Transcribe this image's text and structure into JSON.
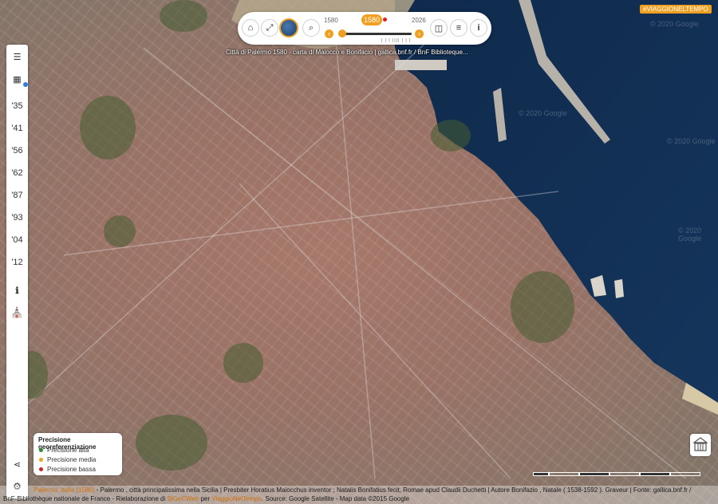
{
  "map": {
    "watermark": "© 2020 Google",
    "hashtag": "#VIAGGIONELTEMPO",
    "caption": "Città di Palermo 1580 - carta di Maiocco e Bonifacio | gallica.bnf.fr / BnF Biblioteque..."
  },
  "sidebar": {
    "items": [
      {
        "id": "menu",
        "icon": "menu-icon",
        "glyph": "☰"
      },
      {
        "id": "map",
        "icon": "map-icon",
        "glyph": "▦"
      },
      {
        "id": "35",
        "label": "'35"
      },
      {
        "id": "41",
        "label": "'41"
      },
      {
        "id": "56",
        "label": "'56"
      },
      {
        "id": "62",
        "label": "'62"
      },
      {
        "id": "87",
        "label": "'87"
      },
      {
        "id": "93",
        "label": "'93"
      },
      {
        "id": "04",
        "label": "'04"
      },
      {
        "id": "12",
        "label": "'12"
      },
      {
        "id": "info",
        "icon": "info-icon",
        "glyph": "ℹ"
      },
      {
        "id": "monument",
        "icon": "monument-icon",
        "glyph": "⛪"
      },
      {
        "id": "share",
        "icon": "share-icon",
        "glyph": "⋖"
      },
      {
        "id": "settings",
        "icon": "gear-icon",
        "glyph": "⚙"
      }
    ],
    "menu_glyph": "☰",
    "map_glyph": "▦",
    "y35": "'35",
    "y41": "'41",
    "y56": "'56",
    "y62": "'62",
    "y87": "'87",
    "y93": "'93",
    "y04": "'04",
    "y12": "'12",
    "info_glyph": "ℹ",
    "monument_glyph": "⛪",
    "share_glyph": "⋖",
    "settings_glyph": "⚙"
  },
  "toolbar": {
    "home_glyph": "⌂",
    "expand_glyph": "⤢",
    "search_glyph": "⌕",
    "compare_glyph": "◫",
    "filters_glyph": "≡",
    "info_glyph": "i",
    "year_min": "1580",
    "year_current": "1580",
    "year_max": "2026",
    "prev_glyph": "‹",
    "next_glyph": "›",
    "ticks": "| | | |||| | | |"
  },
  "legend": {
    "title": "Precisione georeferenziazione",
    "rows": [
      {
        "label": "Precisione alta",
        "color": "#2e8b2e"
      },
      {
        "label": "Precisione media",
        "color": "#f0a020"
      },
      {
        "label": "Precisione bassa",
        "color": "#d02020"
      }
    ]
  },
  "footer": {
    "line1_link": "Palermo, Italia (1580)",
    "line1_text": " - Palermo , città principalissima nella Sicilia | Presbiter Horatius Maiocchus inventor ; Natalis Bonifatius fecit, Romae apud Claudii Duchetti | Autore Bonifazio , Natale ( 1538-1592 ). Graveur | Fonte: gallica.bnf.fr /",
    "line2_text_a": "BnF-Bibliothèque nationale de France - Rielaborazione di ",
    "line2_link_a": "SiGeCWeb",
    "line2_text_b": " per ",
    "line2_link_b": "ViaggioNelTempo",
    "line2_text_c": ". Source: Google Satellite - Map data ©2015 Google"
  },
  "colors": {
    "accent": "#f0a020",
    "sea": "#123055",
    "sidebar_dot": "#2a7de1"
  }
}
